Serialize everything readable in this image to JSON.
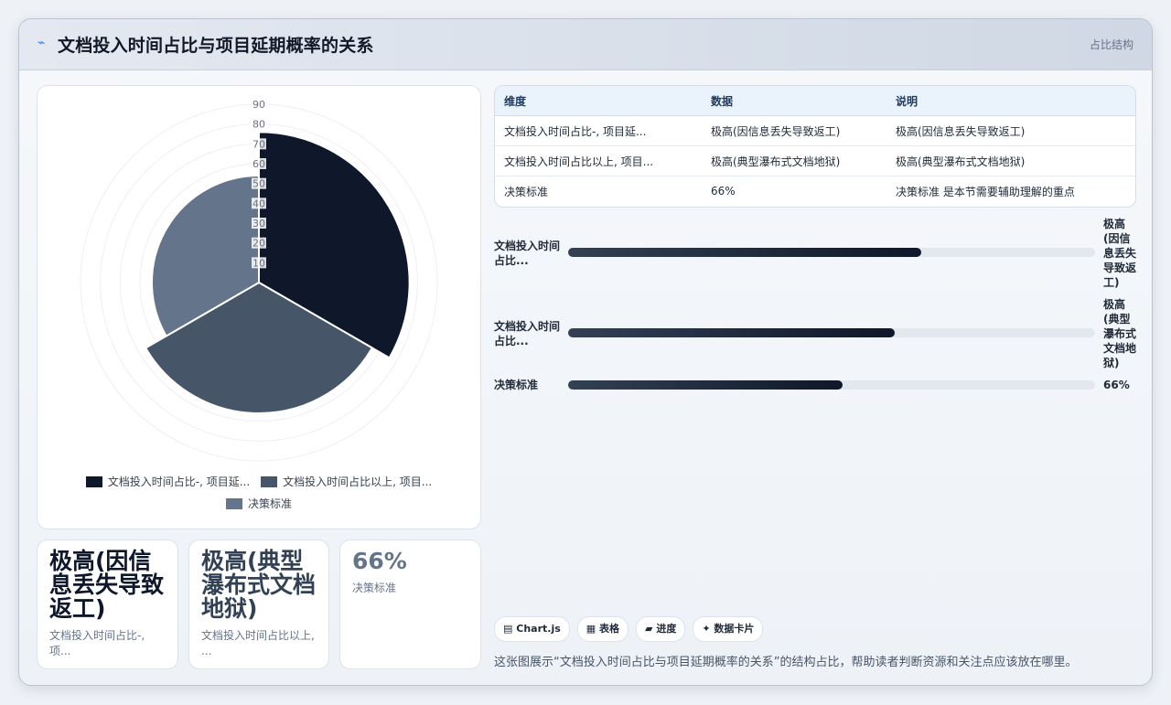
{
  "header": {
    "icon": "chart-icon",
    "title": "文档投入时间占比与项目延期概率的关系",
    "tag": "占比结构"
  },
  "chart_data": {
    "type": "polar-area",
    "categories": [
      "文档投入时间占比-, 项目延...",
      "文档投入时间占比以上, 项目...",
      "决策标准"
    ],
    "values": [
      76,
      66,
      54
    ],
    "rmax": 90,
    "r_ticks": [
      10,
      20,
      30,
      40,
      50,
      60,
      70,
      80,
      90
    ],
    "colors": [
      "#0f172a",
      "#475569",
      "#64748b"
    ],
    "legend_position": "bottom"
  },
  "legend": {
    "items": [
      "文档投入时间占比-, 项目延...",
      "文档投入时间占比以上, 项目...",
      "决策标准"
    ]
  },
  "kpis": [
    {
      "value": "极高(因信息丢失导致返工)",
      "label": "文档投入时间占比-, 项...",
      "color": "#0f172a"
    },
    {
      "value": "极高(典型瀑布式文档地狱)",
      "label": "文档投入时间占比以上, ...",
      "color": "#334155"
    },
    {
      "value": "66%",
      "label": "决策标准",
      "color": "#64748b"
    }
  ],
  "table": {
    "headers": [
      "维度",
      "数据",
      "说明"
    ],
    "rows": [
      [
        "文档投入时间占比-, 项目延...",
        "极高(因信息丢失导致返工)",
        "极高(因信息丢失导致返工)"
      ],
      [
        "文档投入时间占比以上, 项目...",
        "极高(典型瀑布式文档地狱)",
        "极高(典型瀑布式文档地狱)"
      ],
      [
        "决策标准",
        "66%",
        "决策标准 是本节需要辅助理解的重点"
      ]
    ]
  },
  "progress": [
    {
      "label": "文档投入时间占比...",
      "value": "极高(因信息丢失导致返工)",
      "fraction": 0.67
    },
    {
      "label": "文档投入时间占比...",
      "value": "极高(典型瀑布式文档地狱)",
      "fraction": 0.62
    },
    {
      "label": "决策标准",
      "value": "66%",
      "fraction": 0.52
    }
  ],
  "chips": [
    {
      "icon": "chart-icon",
      "glyph": "▤",
      "label": "Chart.js"
    },
    {
      "icon": "table-icon",
      "glyph": "▦",
      "label": "表格"
    },
    {
      "icon": "progress-icon",
      "glyph": "▰",
      "label": "进度"
    },
    {
      "icon": "card-icon",
      "glyph": "✦",
      "label": "数据卡片"
    }
  ],
  "footnote": "这张图展示“文档投入时间占比与项目延期概率的关系”的结构占比，帮助读者判断资源和关注点应该放在哪里。"
}
